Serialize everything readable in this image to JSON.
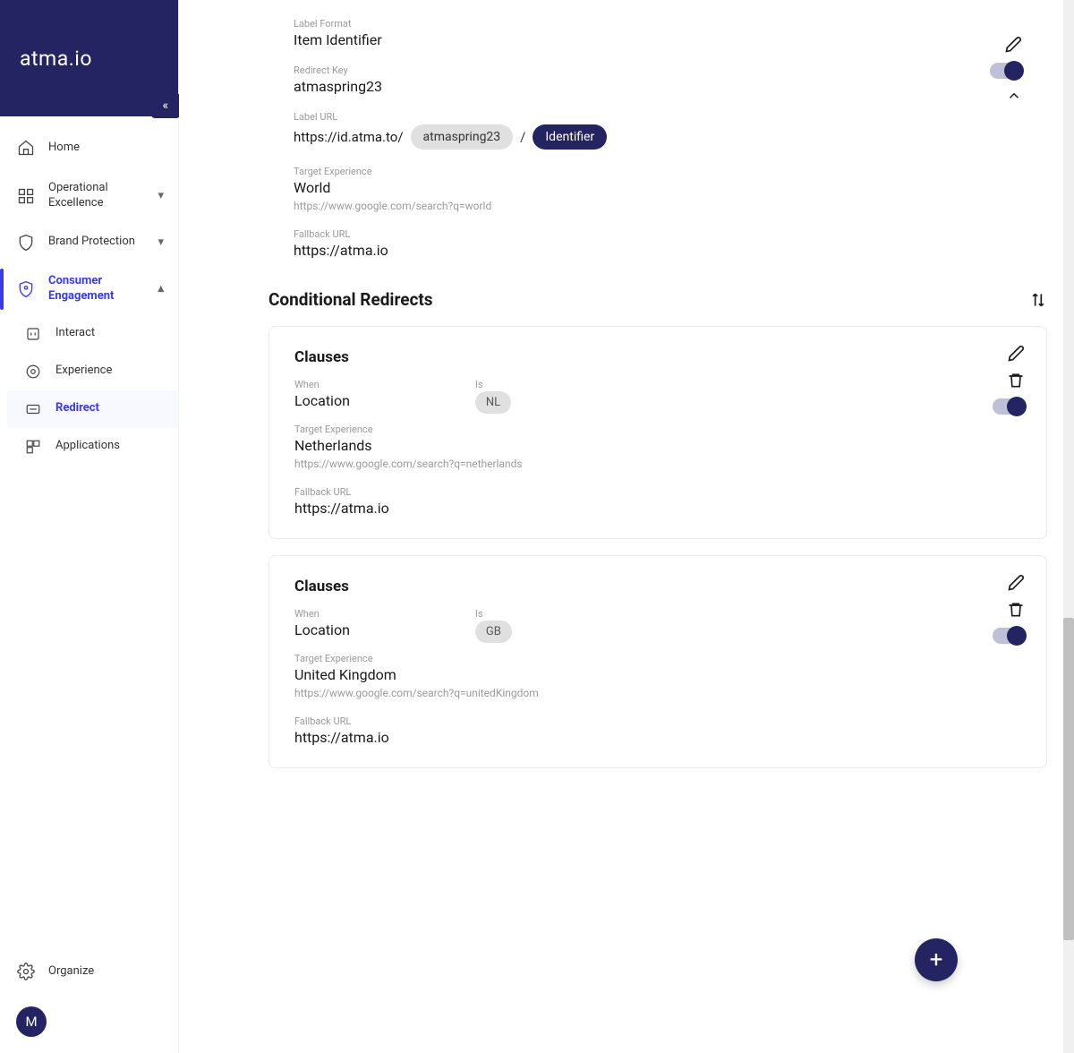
{
  "brand": "atma.io",
  "sidebar": {
    "items": [
      {
        "label": "Home"
      },
      {
        "label": "Operational Excellence"
      },
      {
        "label": "Brand Protection"
      },
      {
        "label": "Consumer Engagement"
      }
    ],
    "sub_items": [
      {
        "label": "Interact"
      },
      {
        "label": "Experience"
      },
      {
        "label": "Redirect"
      },
      {
        "label": "Applications"
      }
    ],
    "footer_label": "Organize",
    "avatar_initial": "M"
  },
  "details": {
    "label_format_label": "Label Format",
    "label_format_value": "Item Identifier",
    "redirect_key_label": "Redirect Key",
    "redirect_key_value": "atmaspring23",
    "label_url_label": "Label URL",
    "label_url_base": "https://id.atma.to/",
    "label_url_chip1": "atmaspring23",
    "label_url_chip2": "Identifier",
    "slash": "/",
    "target_exp_label": "Target Experience",
    "target_exp_value": "World",
    "target_exp_url": "https://www.google.com/search?q=world",
    "fallback_label": "Fallback URL",
    "fallback_value": "https://atma.io"
  },
  "section_title": "Conditional Redirects",
  "clauses": [
    {
      "title": "Clauses",
      "when_label": "When",
      "when_value": "Location",
      "is_label": "Is",
      "is_value": "NL",
      "target_label": "Target Experience",
      "target_value": "Netherlands",
      "target_url": "https://www.google.com/search?q=netherlands",
      "fallback_label": "Fallback URL",
      "fallback_value": "https://atma.io"
    },
    {
      "title": "Clauses",
      "when_label": "When",
      "when_value": "Location",
      "is_label": "Is",
      "is_value": "GB",
      "target_label": "Target Experience",
      "target_value": "United Kingdom",
      "target_url": "https://www.google.com/search?q=unitedKingdom",
      "fallback_label": "Fallback URL",
      "fallback_value": "https://atma.io"
    }
  ]
}
